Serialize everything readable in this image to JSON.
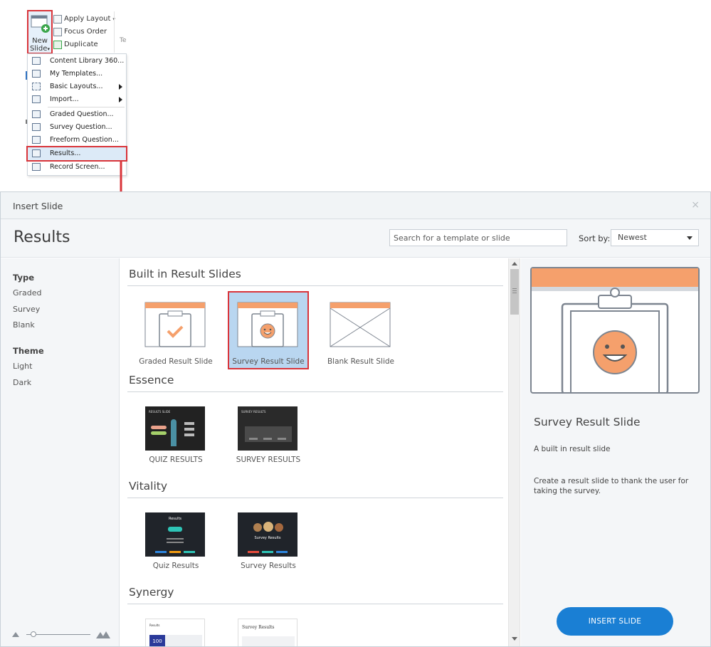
{
  "ribbon": {
    "new_slide_label_1": "New",
    "new_slide_label_2": "Slide",
    "apply_layout": "Apply Layout",
    "focus_order": "Focus Order",
    "duplicate": "Duplicate",
    "te_label": "Te"
  },
  "menu": {
    "items": [
      "Content Library 360...",
      "My Templates...",
      "Basic Layouts...",
      "Import...",
      "Graded Question...",
      "Survey Question...",
      "Freeform Question...",
      "Results...",
      "Record Screen..."
    ]
  },
  "dialog": {
    "title": "Insert Slide",
    "close": "×",
    "heading": "Results",
    "search_placeholder": "Search for a template or slide",
    "sort_label": "Sort by:",
    "sort_value": "Newest"
  },
  "filters": {
    "type_heading": "Type",
    "type_options": [
      "Graded",
      "Survey",
      "Blank"
    ],
    "theme_heading": "Theme",
    "theme_options": [
      "Light",
      "Dark"
    ]
  },
  "sections": [
    {
      "title": "Built in Result Slides",
      "tiles": [
        "Graded Result Slide",
        "Survey Result Slide",
        "Blank Result Slide"
      ]
    },
    {
      "title": "Essence",
      "tiles": [
        "QUIZ RESULTS",
        "SURVEY RESULTS"
      ]
    },
    {
      "title": "Vitality",
      "tiles": [
        "Quiz Results",
        "Survey Results"
      ]
    },
    {
      "title": "Synergy",
      "tiles": []
    }
  ],
  "thumb_text": {
    "essence_quiz_title": "RESULTS SLIDE",
    "essence_survey_title": "SURVEY RESULTS",
    "vitality_quiz_title": "Results",
    "vitality_survey_title": "Survey Results",
    "synergy_1_score": "100",
    "synergy_2_title": "Survey Results",
    "synergy_1_title": "Results"
  },
  "preview": {
    "title": "Survey Result Slide",
    "subtitle": "A built in result slide",
    "description": "Create a result slide to thank the user for taking the survey.",
    "insert_button": "INSERT SLIDE"
  },
  "colors": {
    "accent_orange": "#f5a06c",
    "highlight_red": "#d9343a",
    "insert_blue": "#1a7fd4",
    "selected_bg": "#b9d6f0"
  }
}
